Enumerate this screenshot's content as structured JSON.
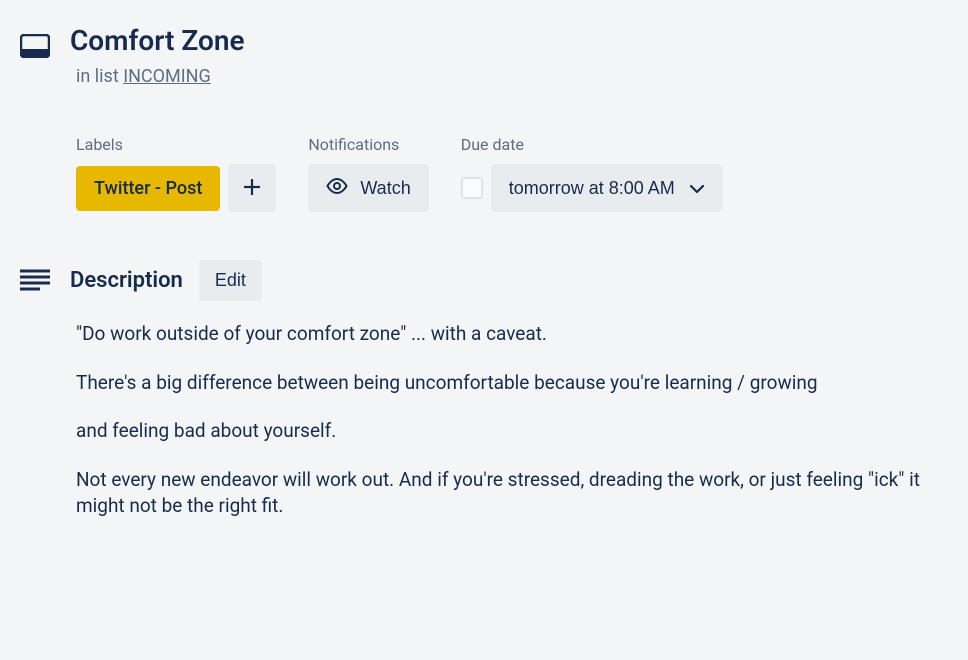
{
  "card": {
    "title": "Comfort Zone",
    "list_prefix": "in list ",
    "list_name": "INCOMING"
  },
  "labels": {
    "section_label": "Labels",
    "items": [
      {
        "name": "Twitter - Post",
        "color": "#e6b800"
      }
    ]
  },
  "notifications": {
    "section_label": "Notifications",
    "watch_label": "Watch"
  },
  "due": {
    "section_label": "Due date",
    "value": "tomorrow at 8:00 AM"
  },
  "description": {
    "section_label": "Description",
    "edit_label": "Edit",
    "paragraphs": [
      "\"Do work outside of your comfort zone\" ... with a caveat.",
      "There's a big difference between being uncomfortable because you're learning / growing",
      "and feeling bad about yourself.",
      "Not every new endeavor will work out. And if you're stressed, dreading the work, or just feeling \"ick\" it might not be the right fit."
    ]
  }
}
